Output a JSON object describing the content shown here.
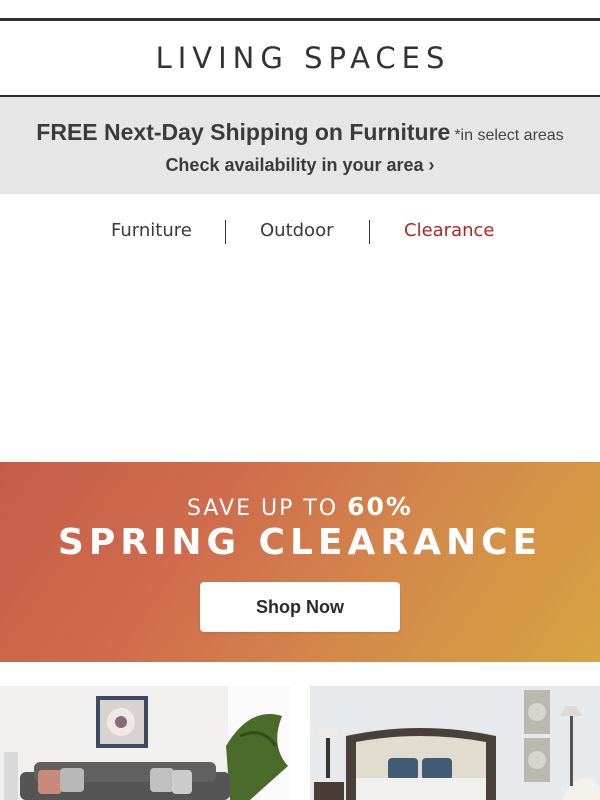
{
  "header": {
    "logo_text": "LIVING SPACES"
  },
  "shipping": {
    "headline": "FREE Next-Day Shipping on Furniture",
    "note": "*in select areas",
    "check_link": "Check availability in your area ›"
  },
  "nav": {
    "items": [
      {
        "label": "Furniture"
      },
      {
        "label": "Outdoor"
      },
      {
        "label": "Clearance",
        "color": "#b3261e"
      }
    ]
  },
  "promo": {
    "save_prefix": "SAVE UP TO",
    "save_value": "60%",
    "title": "SPRING CLEARANCE",
    "button_label": "Shop Now",
    "gradient_start": "#c65c48",
    "gradient_end": "#d6a441"
  },
  "tiles": [
    {
      "icon": "living-room-sofa-image"
    },
    {
      "icon": "bedroom-image"
    }
  ],
  "colors": {
    "text_dark": "#333333",
    "ship_bg": "#e6e6e6",
    "accent_red": "#b3261e"
  }
}
